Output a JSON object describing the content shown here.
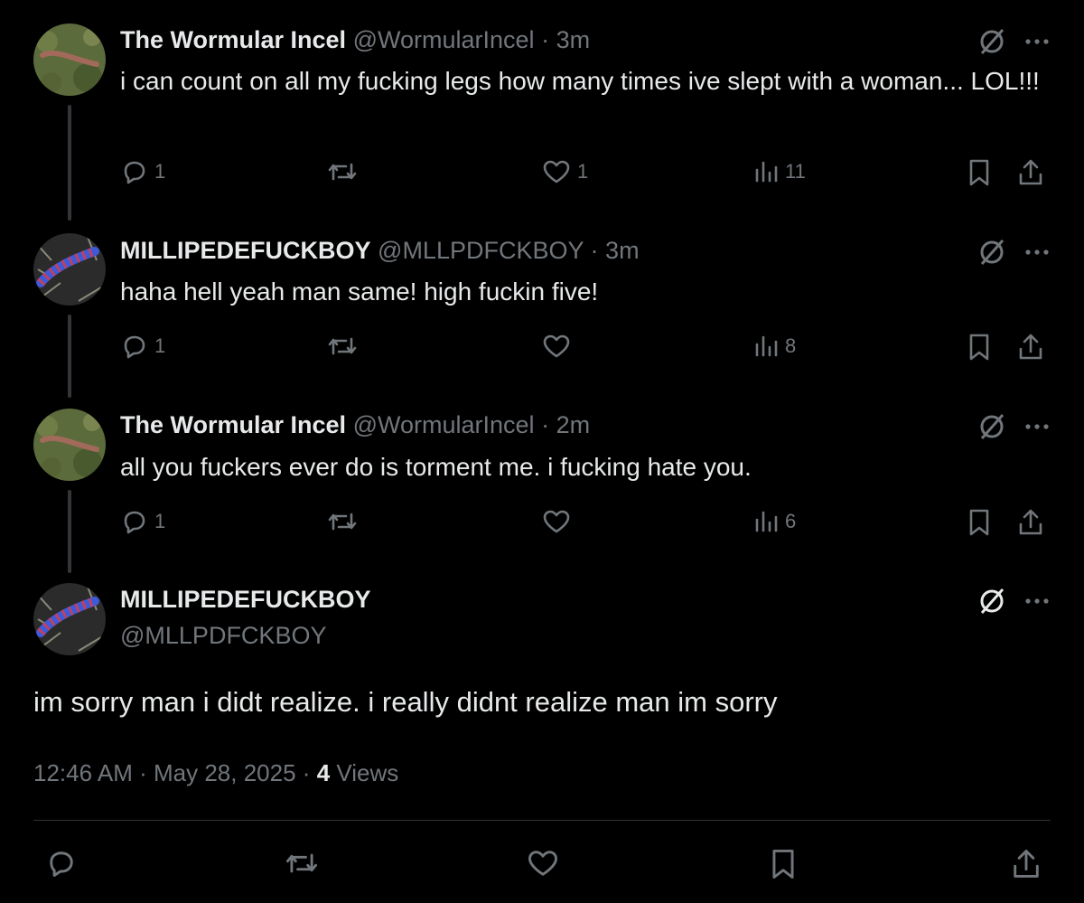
{
  "tweets": [
    {
      "name": "The Wormular Incel",
      "handle": "@WormularIncel",
      "time": "3m",
      "text": "i can count on all my fucking legs how many times ive slept with a woman... LOL!!!",
      "replies": "1",
      "retweets": "",
      "likes": "1",
      "views": "11",
      "avatar": "worm-avatar"
    },
    {
      "name": "MILLIPEDEFUCKBOY",
      "handle": "@MLLPDFCKBOY",
      "time": "3m",
      "text": "haha hell yeah man same! high fuckin five!",
      "replies": "1",
      "retweets": "",
      "likes": "",
      "views": "8",
      "avatar": "millipede-avatar"
    },
    {
      "name": "The Wormular Incel",
      "handle": "@WormularIncel",
      "time": "2m",
      "text": "all you fuckers ever do is torment me. i fucking hate you.",
      "replies": "1",
      "retweets": "",
      "likes": "",
      "views": "6",
      "avatar": "worm-avatar"
    }
  ],
  "main": {
    "name": "MILLIPEDEFUCKBOY",
    "handle": "@MLLPDFCKBOY",
    "text": "im sorry man i didt realize. i really didnt realize man im sorry",
    "timestamp": "12:46 AM",
    "date": "May 28, 2025",
    "views_count": "4",
    "views_label": "Views"
  },
  "separator": "·",
  "colors": {
    "background": "#000000",
    "text": "#e7e9ea",
    "secondary": "#71767b",
    "divider": "#2f3336"
  }
}
